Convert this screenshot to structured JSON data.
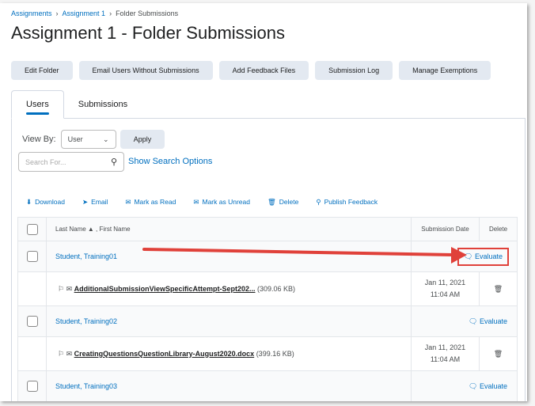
{
  "breadcrumbs": [
    "Assignments",
    "Assignment 1",
    "Folder Submissions"
  ],
  "title": "Assignment 1 - Folder Submissions",
  "buttons": [
    "Edit Folder",
    "Email Users Without Submissions",
    "Add Feedback Files",
    "Submission Log",
    "Manage Exemptions"
  ],
  "tabs": [
    "Users",
    "Submissions"
  ],
  "view_by": {
    "label": "View By:",
    "value": "User",
    "apply": "Apply"
  },
  "search": {
    "placeholder": "Search For...",
    "options_link": "Show Search Options"
  },
  "actions": [
    "Download",
    "Email",
    "Mark as Read",
    "Mark as Unread",
    "Delete",
    "Publish Feedback"
  ],
  "table": {
    "headers": {
      "name": "Last Name ▲ , First Name",
      "date": "Submission Date",
      "delete": "Delete"
    },
    "rows": [
      {
        "name": "Student, Training01",
        "evaluate": "Evaluate",
        "file": "AdditionalSubmissionViewSpecificAttempt-Sept202...",
        "size": "(309.06 KB)",
        "date": "Jan 11, 2021",
        "time": "11:04 AM"
      },
      {
        "name": "Student, Training02",
        "evaluate": "Evaluate",
        "file": "CreatingQuestionsQuestionLibrary-August2020.docx",
        "size": "(399.16 KB)",
        "date": "Jan 11, 2021",
        "time": "11:04 AM"
      },
      {
        "name": "Student, Training03",
        "evaluate": "Evaluate"
      }
    ]
  },
  "colors": {
    "link": "#006fbf",
    "highlight": "#e0413a"
  }
}
